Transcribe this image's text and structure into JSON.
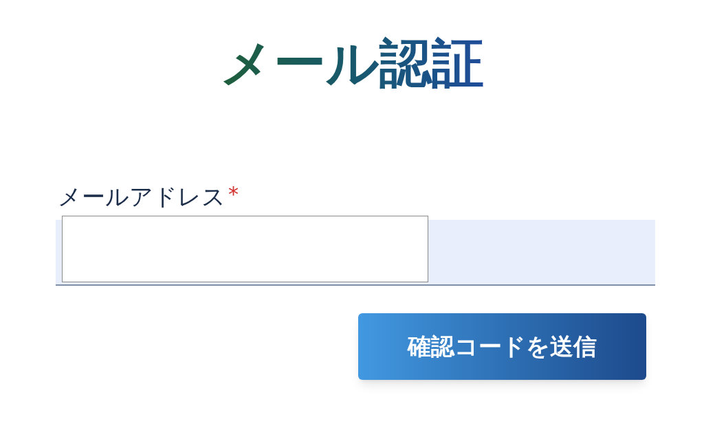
{
  "title": "メール認証",
  "email_field": {
    "label": "メールアドレス",
    "required_mark": "*"
  },
  "submit_button": {
    "label": "確認コードを送信"
  }
}
